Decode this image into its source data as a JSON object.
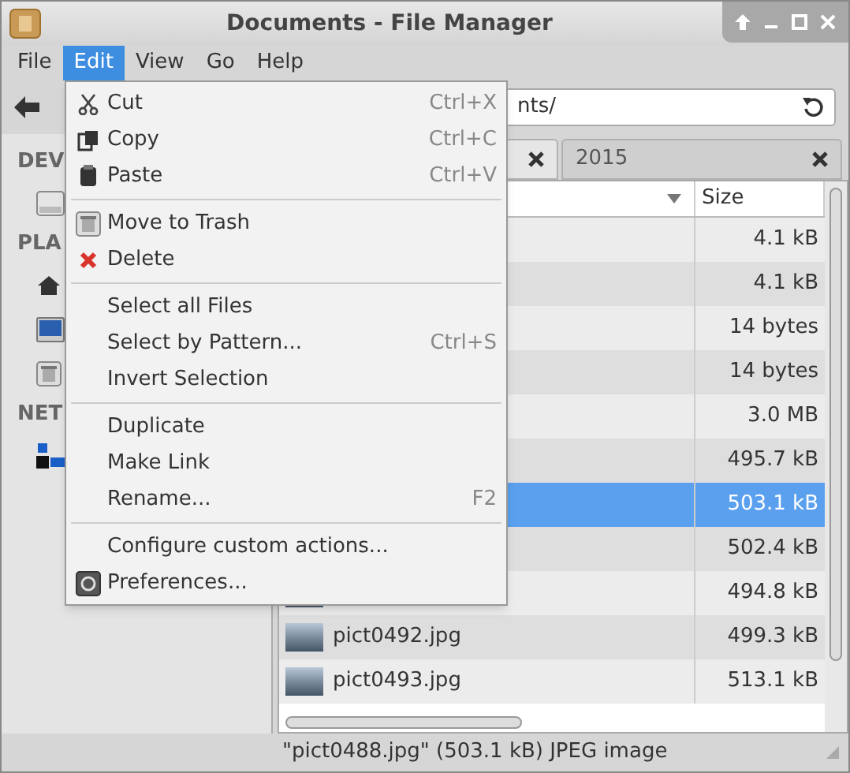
{
  "window": {
    "title": "Documents - File Manager"
  },
  "menubar": [
    {
      "label": "File",
      "selected": false
    },
    {
      "label": "Edit",
      "selected": true
    },
    {
      "label": "View",
      "selected": false
    },
    {
      "label": "Go",
      "selected": false
    },
    {
      "label": "Help",
      "selected": false
    }
  ],
  "location": {
    "value": "nts/"
  },
  "sidebar": {
    "sections": [
      {
        "heading": "DEV"
      },
      {
        "heading": "PLA"
      },
      {
        "heading": "NET"
      }
    ]
  },
  "tabs": [
    {
      "selected": true
    },
    {
      "label": "2015",
      "selected": false
    }
  ],
  "table": {
    "columns": [
      "Size"
    ],
    "rows": [
      {
        "size": "4.1 kB",
        "selected": false
      },
      {
        "size": "4.1 kB",
        "selected": false
      },
      {
        "size": "14 bytes",
        "selected": false
      },
      {
        "size": "14 bytes",
        "selected": false
      },
      {
        "size": "3.0 MB",
        "selected": false
      },
      {
        "size": "495.7 kB",
        "selected": false
      },
      {
        "size": "503.1 kB",
        "selected": true
      },
      {
        "size": "502.4 kB",
        "selected": false
      },
      {
        "size": "494.8 kB",
        "selected": false
      },
      {
        "name": "pict0492.jpg",
        "size": "499.3 kB",
        "selected": false
      },
      {
        "name": "pict0493.jpg",
        "size": "513.1 kB",
        "selected": false
      }
    ]
  },
  "menu": [
    {
      "kind": "item",
      "label": "Cut",
      "shortcut": "Ctrl+X"
    },
    {
      "kind": "item",
      "label": "Copy",
      "shortcut": "Ctrl+C"
    },
    {
      "kind": "item",
      "label": "Paste",
      "shortcut": "Ctrl+V"
    },
    {
      "kind": "separator"
    },
    {
      "kind": "item",
      "label": "Move to Trash"
    },
    {
      "kind": "item",
      "label": "Delete"
    },
    {
      "kind": "separator"
    },
    {
      "kind": "item",
      "label": "Select all Files"
    },
    {
      "kind": "item",
      "label": "Select by Pattern...",
      "shortcut": "Ctrl+S"
    },
    {
      "kind": "item",
      "label": "Invert Selection"
    },
    {
      "kind": "separator"
    },
    {
      "kind": "item",
      "label": "Duplicate"
    },
    {
      "kind": "item",
      "label": "Make Link"
    },
    {
      "kind": "item",
      "label": "Rename...",
      "shortcut": "F2"
    },
    {
      "kind": "separator"
    },
    {
      "kind": "item",
      "label": "Configure custom actions..."
    },
    {
      "kind": "item",
      "label": "Preferences..."
    }
  ],
  "status_bar": "\"pict0488.jpg\" (503.1 kB) JPEG image"
}
